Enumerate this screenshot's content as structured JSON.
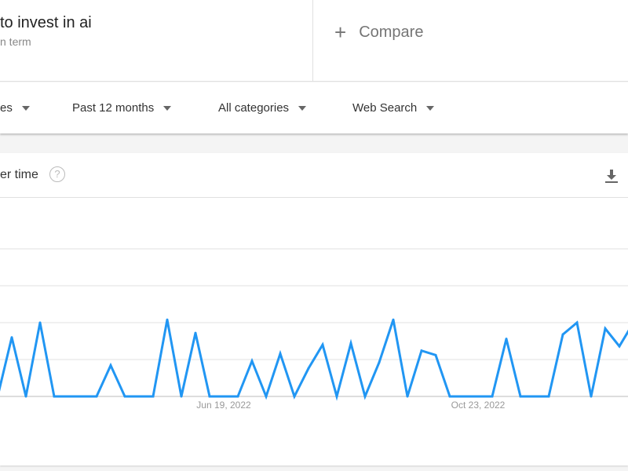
{
  "search": {
    "term": "to invest in ai",
    "subtitle": "n term"
  },
  "compare": {
    "icon": "plus-icon",
    "label": "Compare"
  },
  "filters": [
    {
      "label": "es"
    },
    {
      "label": "Past 12 months"
    },
    {
      "label": "All categories"
    },
    {
      "label": "Web Search"
    }
  ],
  "card": {
    "title": "er time",
    "help_icon": "?",
    "download_icon": "download-icon"
  },
  "chart_data": {
    "type": "line",
    "color": "#2196f3",
    "x_tick_labels": [
      "Jun 19, 2022",
      "Oct 23, 2022"
    ],
    "x": [
      "2022-02-27",
      "2022-03-06",
      "2022-03-13",
      "2022-03-20",
      "2022-03-27",
      "2022-04-03",
      "2022-04-10",
      "2022-04-17",
      "2022-04-24",
      "2022-05-01",
      "2022-05-08",
      "2022-05-15",
      "2022-05-22",
      "2022-05-29",
      "2022-06-05",
      "2022-06-12",
      "2022-06-19",
      "2022-06-26",
      "2022-07-03",
      "2022-07-10",
      "2022-07-17",
      "2022-07-24",
      "2022-07-31",
      "2022-08-07",
      "2022-08-14",
      "2022-08-21",
      "2022-08-28",
      "2022-09-04",
      "2022-09-11",
      "2022-09-18",
      "2022-09-25",
      "2022-10-02",
      "2022-10-09",
      "2022-10-16",
      "2022-10-23",
      "2022-10-30",
      "2022-11-06",
      "2022-11-13",
      "2022-11-20",
      "2022-11-27",
      "2022-12-04",
      "2022-12-11",
      "2022-12-18",
      "2022-12-25",
      "2023-01-01",
      "2023-01-08"
    ],
    "values": [
      0,
      40,
      0,
      50,
      0,
      0,
      0,
      0,
      21,
      0,
      0,
      0,
      52,
      0,
      43,
      0,
      0,
      0,
      24,
      0,
      29,
      0,
      19,
      35,
      0,
      36,
      0,
      23,
      52,
      0,
      31,
      28,
      0,
      0,
      0,
      0,
      39,
      0,
      0,
      0,
      42,
      50,
      0,
      46,
      34,
      50
    ],
    "ylim": [
      0,
      100
    ],
    "grid": true
  }
}
